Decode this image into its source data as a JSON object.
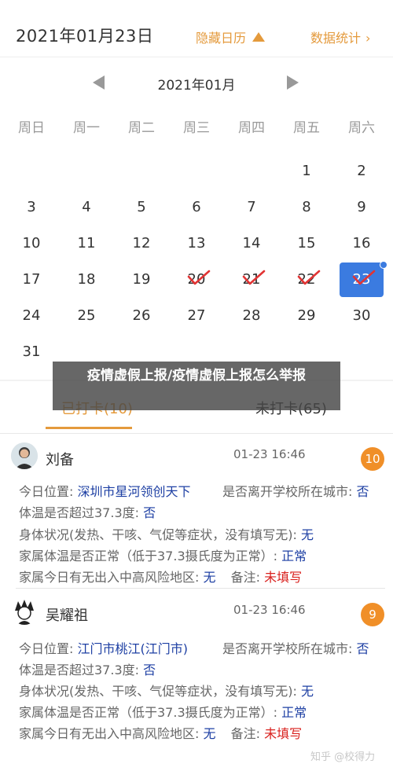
{
  "header": {
    "date_title": "2021年01月23日",
    "hide_calendar": "隐藏日历",
    "stats": "数据统计",
    "stats_arrow": "›"
  },
  "calendar": {
    "month_label": "2021年01月",
    "weekdays": [
      "周日",
      "周一",
      "周二",
      "周三",
      "周四",
      "周五",
      "周六"
    ],
    "weeks": [
      [
        "",
        "",
        "",
        "",
        "",
        "1",
        "2"
      ],
      [
        "3",
        "4",
        "5",
        "6",
        "7",
        "8",
        "9"
      ],
      [
        "10",
        "11",
        "12",
        "13",
        "14",
        "15",
        "16"
      ],
      [
        "17",
        "18",
        "19",
        "20",
        "21",
        "22",
        "23"
      ],
      [
        "24",
        "25",
        "26",
        "27",
        "28",
        "29",
        "30"
      ],
      [
        "31",
        "",
        "",
        "",
        "",
        "",
        ""
      ]
    ],
    "checked_days": [
      "20",
      "21",
      "22"
    ],
    "selected_day": "23",
    "accent_color": "#e49a3c",
    "selected_color": "#3b7be0"
  },
  "overlay_title": "疫情虚假上报/疫情虚假上报怎么举报",
  "tabs": {
    "done": "已打卡(10)",
    "todo": "未打卡(65)"
  },
  "records": [
    {
      "name": "刘备",
      "time": "01-23 16:46",
      "badge": "10",
      "location_label": "今日位置: ",
      "location_value": "深圳市星河领创天下",
      "left_city_label": "是否离开学校所在城市: ",
      "left_city_value": "否",
      "temp_label": "体温是否超过37.3度: ",
      "temp_value": "否",
      "health_label": "身体状况(发热、干咳、气促等症状，没有填写无): ",
      "health_value": "无",
      "family_temp_label": "家属体温是否正常（低于37.3摄氏度为正常）: ",
      "family_temp_value": "正常",
      "family_risk_label": "家属今日有无出入中高风险地区: ",
      "family_risk_value": "无",
      "note_label": "备注: ",
      "note_value": "未填写"
    },
    {
      "name": "吴耀祖",
      "time": "01-23 16:46",
      "badge": "9",
      "location_label": "今日位置: ",
      "location_value": "江门市桃江(江门市)",
      "left_city_label": "是否离开学校所在城市: ",
      "left_city_value": "否",
      "temp_label": "体温是否超过37.3度: ",
      "temp_value": "否",
      "health_label": "身体状况(发热、干咳、气促等症状，没有填写无): ",
      "health_value": "无",
      "family_temp_label": "家属体温是否正常（低于37.3摄氏度为正常）: ",
      "family_temp_value": "正常",
      "family_risk_label": "家属今日有无出入中高风险地区: ",
      "family_risk_value": "无",
      "note_label": "备注: ",
      "note_value": "未填写"
    }
  ],
  "watermark": "知乎 @校得力"
}
